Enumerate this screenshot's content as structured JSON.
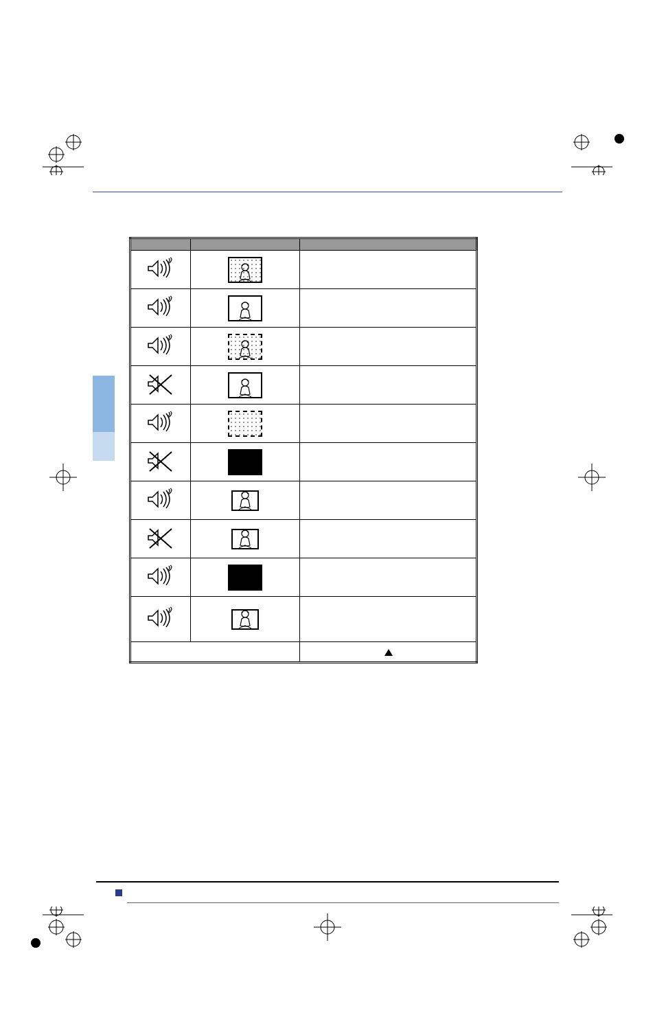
{
  "table": {
    "headers": [
      "",
      "",
      ""
    ],
    "rows": [
      {
        "sound": "on",
        "image": "portrait-noisy",
        "desc": ""
      },
      {
        "sound": "on",
        "image": "portrait",
        "desc": ""
      },
      {
        "sound": "on",
        "image": "portrait-dashed-noisy",
        "desc": ""
      },
      {
        "sound": "off",
        "image": "portrait",
        "desc": ""
      },
      {
        "sound": "on",
        "image": "noisy-empty",
        "desc": ""
      },
      {
        "sound": "off",
        "image": "black",
        "desc": ""
      },
      {
        "sound": "on",
        "image": "portrait-small",
        "desc": ""
      },
      {
        "sound": "off",
        "image": "portrait-small",
        "desc": ""
      },
      {
        "sound": "on",
        "image": "black",
        "desc": ""
      },
      {
        "sound": "on",
        "image": "portrait-small",
        "desc": "",
        "hasTriangle": true
      }
    ],
    "footnote": ""
  }
}
